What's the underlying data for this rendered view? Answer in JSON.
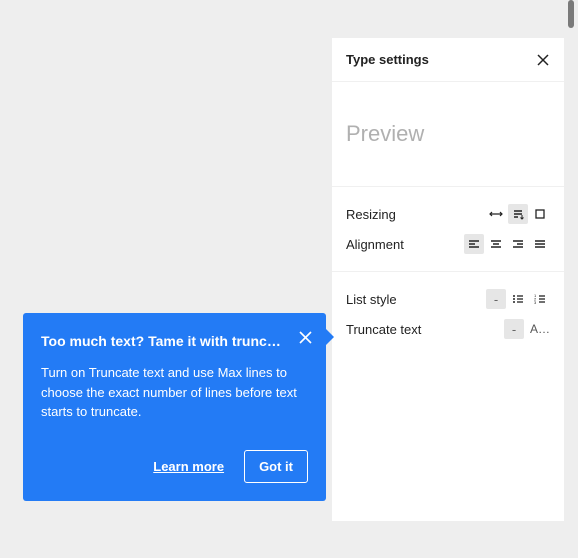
{
  "panel": {
    "title": "Type settings",
    "preview": "Preview",
    "rows": {
      "resizing": {
        "label": "Resizing"
      },
      "alignment": {
        "label": "Alignment"
      },
      "listStyle": {
        "label": "List style",
        "value": "-"
      },
      "truncate": {
        "label": "Truncate text",
        "value": "-",
        "extra": "A…"
      }
    }
  },
  "tip": {
    "title": "Too much text? Tame it with truncation",
    "body": "Turn on Truncate text and use Max lines to choose the exact number of lines before text starts to truncate.",
    "learnMore": "Learn more",
    "gotIt": "Got it"
  }
}
